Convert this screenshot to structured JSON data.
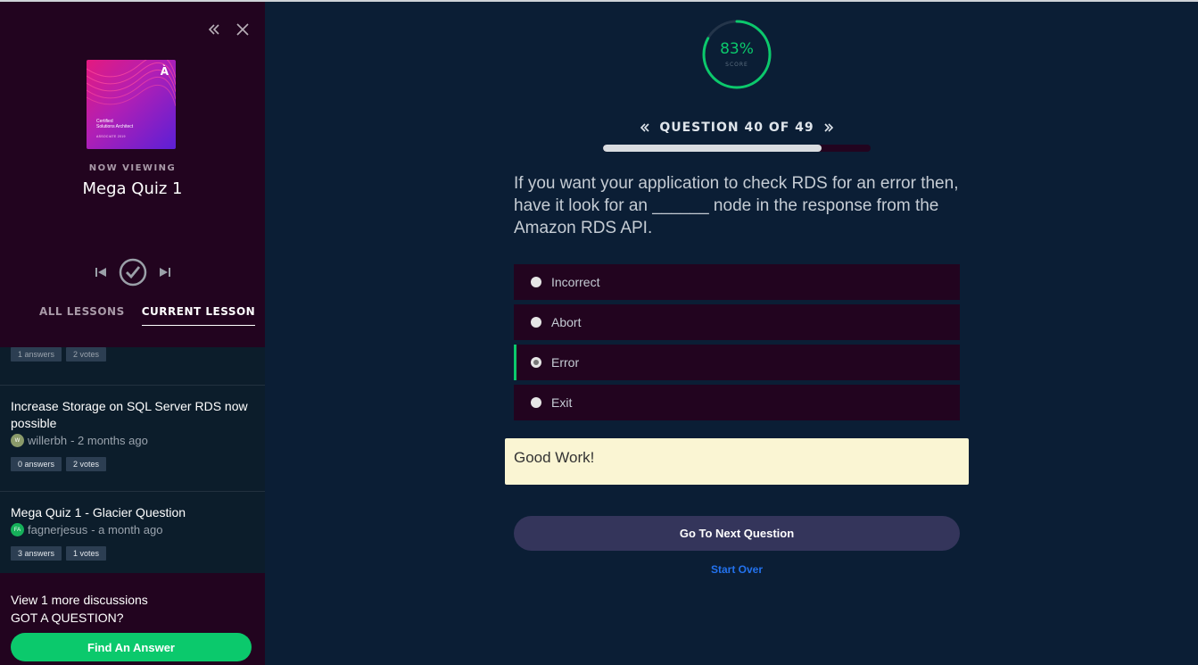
{
  "sidebar": {
    "course_card": {
      "title_line1": "Certified",
      "title_line2": "Solutions Architect",
      "subtitle": "ASSOCIATE 2019",
      "logo": "À"
    },
    "now_viewing_label": "NOW VIEWING",
    "lesson_title": "Mega Quiz 1",
    "tabs": [
      {
        "label": "ALL LESSONS",
        "active": false
      },
      {
        "label": "CURRENT LESSON",
        "active": true
      }
    ],
    "discussions": [
      {
        "answers": "1 answers",
        "votes": "2 votes"
      },
      {
        "title": "Increase Storage on SQL Server RDS now possible",
        "author": "willerbh",
        "time": " - 2 months ago",
        "avatar_initials": "W",
        "avatar_color": "#8a9a6a",
        "answers": "0 answers",
        "votes": "2 votes"
      },
      {
        "title": "Mega Quiz 1 - Glacier Question",
        "author": "fagnerjesus",
        "time": " - a month ago",
        "avatar_initials": "FA",
        "avatar_color": "#16b05a",
        "answers": "3 answers",
        "votes": "1 votes"
      }
    ],
    "view_more": "View 1 more discussions",
    "got_question": "GOT A QUESTION?",
    "find_answer_button": "Find An Answer"
  },
  "quiz": {
    "score_percent": "83%",
    "score_value": 0.83,
    "score_label": "SCORE",
    "question_label": "QUESTION 40 OF 49",
    "progress": 0.8163,
    "question_text": "If you want your application to check RDS for an error then, have it look for an ______ node in the response from the Amazon RDS API.",
    "options": [
      {
        "label": "Incorrect",
        "selected": false
      },
      {
        "label": "Abort",
        "selected": false
      },
      {
        "label": "Error",
        "selected": true
      },
      {
        "label": "Exit",
        "selected": false
      }
    ],
    "feedback": "Good Work!",
    "next_button": "Go To Next Question",
    "start_over": "Start Over"
  },
  "colors": {
    "accent_green": "#0bc96c",
    "main_bg": "#0b1e35",
    "sidebar_bg": "#22041f",
    "link_blue": "#2372ee"
  }
}
